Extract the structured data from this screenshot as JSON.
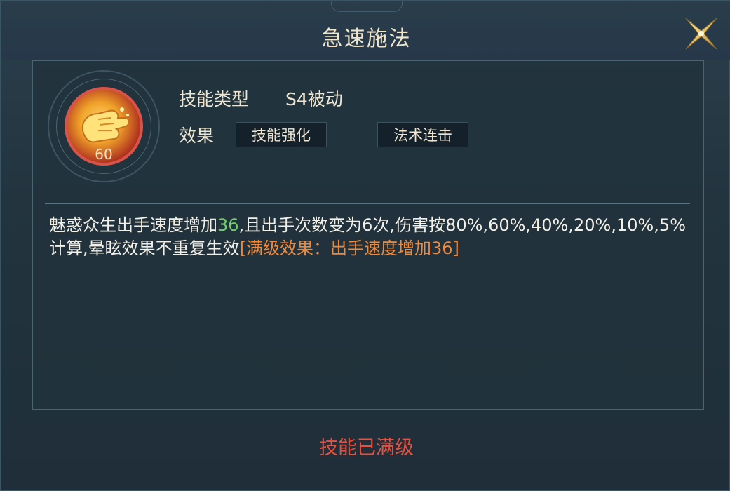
{
  "dialog": {
    "title": "急速施法",
    "close_icon": "close-x-icon"
  },
  "skill": {
    "icon": "golden-fist-icon",
    "level": "60",
    "type_label": "技能类型",
    "type_value": "S4被动",
    "effect_label": "效果",
    "tags": [
      "技能强化",
      "法术连击"
    ]
  },
  "description": {
    "part1": "魅惑众生出手速度增加",
    "speed_value": "36",
    "part2": ",且出手次数变为6次,伤害按80%,60%,40%,20%,10%,5%计算,晕眩效果不重复生效",
    "full_level_effect": "[满级效果：出手速度增加36]"
  },
  "status_text": "技能已满级",
  "colors": {
    "highlight_number": "#6fcf6a",
    "full_level": "#f08a3a",
    "status": "#e8503f"
  }
}
